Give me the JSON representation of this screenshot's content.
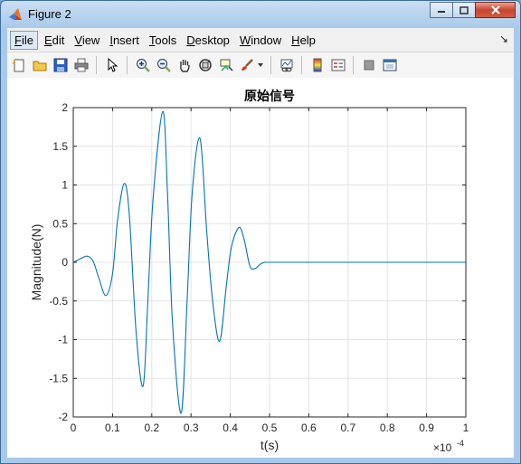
{
  "window": {
    "title": "Figure 2"
  },
  "menu": {
    "items": [
      {
        "label": "File",
        "u": "F",
        "rest": "ile",
        "active": true
      },
      {
        "label": "Edit",
        "u": "E",
        "rest": "dit"
      },
      {
        "label": "View",
        "u": "V",
        "rest": "iew"
      },
      {
        "label": "Insert",
        "u": "I",
        "rest": "nsert"
      },
      {
        "label": "Tools",
        "u": "T",
        "rest": "ools"
      },
      {
        "label": "Desktop",
        "u": "D",
        "rest": "esktop"
      },
      {
        "label": "Window",
        "u": "W",
        "rest": "indow"
      },
      {
        "label": "Help",
        "u": "H",
        "rest": "elp"
      }
    ]
  },
  "toolbar": {
    "icons": [
      "new-figure-icon",
      "open-file-icon",
      "save-icon",
      "print-icon",
      "pointer-icon",
      "zoom-in-icon",
      "zoom-out-icon",
      "pan-hand-icon",
      "rotate-3d-icon",
      "data-cursor-icon",
      "brush-icon",
      "link-plot-icon",
      "colorbar-icon",
      "legend-icon",
      "hide-plot-tools-icon",
      "show-plot-tools-icon"
    ]
  },
  "chart_data": {
    "type": "line",
    "title": "原始信号",
    "xlabel": "t(s)",
    "ylabel": "Magnitude(N)",
    "x_exponent_label": "×10",
    "x_exponent_power": "-4",
    "xlim": [
      0,
      1
    ],
    "ylim": [
      -2,
      2
    ],
    "x_ticks": [
      "0",
      "0.1",
      "0.2",
      "0.3",
      "0.4",
      "0.5",
      "0.6",
      "0.7",
      "0.8",
      "0.9",
      "1"
    ],
    "y_ticks": [
      "2",
      "1.5",
      "1",
      "0.5",
      "0",
      "-0.5",
      "-1",
      "-1.5",
      "-2"
    ],
    "grid": true,
    "line_color": "#0072bd",
    "series": [
      {
        "x": [
          0,
          0.02,
          0.035,
          0.05,
          0.065,
          0.083,
          0.1,
          0.113,
          0.13,
          0.143,
          0.16,
          0.178,
          0.19,
          0.203,
          0.228,
          0.24,
          0.253,
          0.275,
          0.29,
          0.303,
          0.323,
          0.34,
          0.355,
          0.373,
          0.39,
          0.403,
          0.422,
          0.435,
          0.45,
          0.463,
          0.475,
          0.487,
          0.5,
          0.6,
          0.7,
          0.8,
          0.9,
          1.0
        ],
        "y": [
          0,
          0.05,
          0.08,
          0.02,
          -0.2,
          -0.43,
          -0.15,
          0.55,
          1.02,
          0.6,
          -0.9,
          -1.6,
          -0.5,
          0.8,
          1.95,
          0.9,
          -0.8,
          -1.95,
          -0.5,
          0.9,
          1.6,
          0.4,
          -0.5,
          -1.02,
          -0.3,
          0.2,
          0.45,
          0.3,
          -0.05,
          -0.08,
          -0.03,
          0.0,
          0,
          0,
          0,
          0,
          0,
          0
        ]
      }
    ]
  }
}
